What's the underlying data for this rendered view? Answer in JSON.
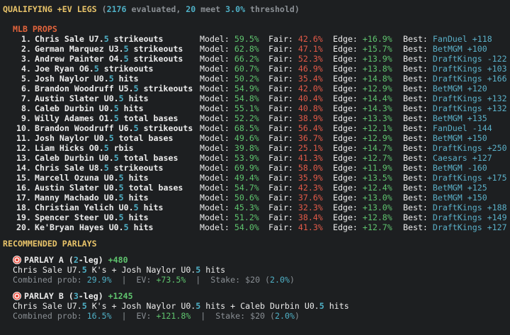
{
  "header": {
    "title": "QUALIFYING +EV LEGS",
    "paren_open": "(",
    "evaluated_count": "2176",
    "evaluated_text": " evaluated, ",
    "meet_count": "20",
    "meet_text": " meet ",
    "threshold_pct": "3.0%",
    "threshold_text": " threshold)"
  },
  "mlb": {
    "title": "MLB PROPS",
    "labels": {
      "model": "Model:",
      "fair": "Fair:",
      "edge": "Edge:",
      "best": "Best:"
    },
    "rows": [
      {
        "num": "1.",
        "pre": "Chris Sale U7.",
        "bold": "5",
        "post": " strikeouts",
        "model": "59.5%",
        "fair": "42.6%",
        "edge": "+16.9%",
        "book": "FanDuel",
        "odds": "+118"
      },
      {
        "num": "2.",
        "pre": "German Marquez U3.",
        "bold": "5",
        "post": " strikeouts",
        "model": "62.8%",
        "fair": "47.1%",
        "edge": "+15.7%",
        "book": "BetMGM",
        "odds": "+100"
      },
      {
        "num": "3.",
        "pre": "Andrew Painter O4.",
        "bold": "5",
        "post": " strikeouts",
        "model": "66.2%",
        "fair": "52.3%",
        "edge": "+13.9%",
        "book": "DraftKings",
        "odds": "-122"
      },
      {
        "num": "4.",
        "pre": "Joe Ryan O6.",
        "bold": "5",
        "post": " strikeouts",
        "model": "60.7%",
        "fair": "46.9%",
        "edge": "+13.8%",
        "book": "DraftKings",
        "odds": "+103"
      },
      {
        "num": "5.",
        "pre": "Josh Naylor U0.",
        "bold": "5",
        "post": " hits",
        "model": "50.2%",
        "fair": "35.4%",
        "edge": "+14.8%",
        "book": "DraftKings",
        "odds": "+166"
      },
      {
        "num": "6.",
        "pre": "Brandon Woodruff U5.",
        "bold": "5",
        "post": " strikeouts",
        "model": "54.9%",
        "fair": "42.0%",
        "edge": "+12.9%",
        "book": "BetMGM",
        "odds": "+120"
      },
      {
        "num": "7.",
        "pre": "Austin Slater U0.",
        "bold": "5",
        "post": " hits",
        "model": "54.8%",
        "fair": "40.4%",
        "edge": "+14.4%",
        "book": "DraftKings",
        "odds": "+132"
      },
      {
        "num": "8.",
        "pre": "Caleb Durbin U0.",
        "bold": "5",
        "post": " hits",
        "model": "55.1%",
        "fair": "40.8%",
        "edge": "+14.3%",
        "book": "DraftKings",
        "odds": "+132"
      },
      {
        "num": "9.",
        "pre": "Willy Adames O1.",
        "bold": "5",
        "post": " total bases",
        "model": "52.2%",
        "fair": "38.9%",
        "edge": "+13.3%",
        "book": "BetMGM",
        "odds": "+135"
      },
      {
        "num": "10.",
        "pre": "Brandon Woodruff U6.",
        "bold": "5",
        "post": " strikeouts",
        "model": "68.5%",
        "fair": "56.4%",
        "edge": "+12.1%",
        "book": "FanDuel",
        "odds": "-144"
      },
      {
        "num": "11.",
        "pre": "Josh Naylor U0.",
        "bold": "5",
        "post": " total bases",
        "model": "49.6%",
        "fair": "36.7%",
        "edge": "+12.9%",
        "book": "BetMGM",
        "odds": "+150"
      },
      {
        "num": "12.",
        "pre": "Liam Hicks O0.",
        "bold": "5",
        "post": " rbis",
        "model": "39.8%",
        "fair": "25.1%",
        "edge": "+14.7%",
        "book": "DraftKings",
        "odds": "+250"
      },
      {
        "num": "13.",
        "pre": "Caleb Durbin U0.",
        "bold": "5",
        "post": " total bases",
        "model": "53.9%",
        "fair": "41.3%",
        "edge": "+12.7%",
        "book": "Caesars",
        "odds": "+127"
      },
      {
        "num": "14.",
        "pre": "Chris Sale U8.",
        "bold": "5",
        "post": " strikeouts",
        "model": "69.9%",
        "fair": "58.0%",
        "edge": "+11.9%",
        "book": "BetMGM",
        "odds": "-160"
      },
      {
        "num": "15.",
        "pre": "Marcell Ozuna U0.",
        "bold": "5",
        "post": " hits",
        "model": "49.4%",
        "fair": "35.9%",
        "edge": "+13.5%",
        "book": "DraftKings",
        "odds": "+175"
      },
      {
        "num": "16.",
        "pre": "Austin Slater U0.",
        "bold": "5",
        "post": " total bases",
        "model": "54.7%",
        "fair": "42.3%",
        "edge": "+12.4%",
        "book": "BetMGM",
        "odds": "+125"
      },
      {
        "num": "17.",
        "pre": "Manny Machado U0.",
        "bold": "5",
        "post": " hits",
        "model": "50.6%",
        "fair": "37.6%",
        "edge": "+13.0%",
        "book": "BetMGM",
        "odds": "+150"
      },
      {
        "num": "18.",
        "pre": "Christian Yelich U0.",
        "bold": "5",
        "post": " hits",
        "model": "45.3%",
        "fair": "32.3%",
        "edge": "+13.0%",
        "book": "DraftKings",
        "odds": "+188"
      },
      {
        "num": "19.",
        "pre": "Spencer Steer U0.",
        "bold": "5",
        "post": " hits",
        "model": "51.2%",
        "fair": "38.4%",
        "edge": "+12.8%",
        "book": "DraftKings",
        "odds": "+149"
      },
      {
        "num": "20.",
        "pre": "Ke'Bryan Hayes U0.",
        "bold": "5",
        "post": " hits",
        "model": "54.0%",
        "fair": "41.3%",
        "edge": "+12.7%",
        "book": "DraftKings",
        "odds": "+127"
      }
    ]
  },
  "parlays": {
    "title": "RECOMMENDED PARLAYS",
    "labels": {
      "combined": "Combined prob: ",
      "ev": "EV: ",
      "stake": "Stake: ",
      "sep": "  |  "
    },
    "items": [
      {
        "label": "PARLAY A",
        "legs_paren_open": " (",
        "legs_num": "2",
        "legs_text": "-leg)",
        "odds": " +480",
        "legs_line": [
          {
            "t": "Chris Sale U7.",
            "k": "w"
          },
          {
            "t": "5",
            "k": "b"
          },
          {
            "t": " K's + Josh Naylor U0.",
            "k": "w"
          },
          {
            "t": "5",
            "k": "b"
          },
          {
            "t": " hits",
            "k": "w"
          }
        ],
        "prob": "29.9%",
        "ev": "+73.5%",
        "stake": "$20",
        "stake_pct_open": " (",
        "stake_pct": "2.0%",
        "stake_pct_close": ")"
      },
      {
        "label": "PARLAY B",
        "legs_paren_open": " (",
        "legs_num": "3",
        "legs_text": "-leg)",
        "odds": " +1245",
        "legs_line": [
          {
            "t": "Chris Sale U7.",
            "k": "w"
          },
          {
            "t": "5",
            "k": "b"
          },
          {
            "t": " K's + Josh Naylor U0.",
            "k": "w"
          },
          {
            "t": "5",
            "k": "b"
          },
          {
            "t": " hits + Caleb Durbin U0.",
            "k": "w"
          },
          {
            "t": "5",
            "k": "b"
          },
          {
            "t": " hits",
            "k": "w"
          }
        ],
        "prob": "16.5%",
        "ev": "+121.8%",
        "stake": "$20",
        "stake_pct_open": " (",
        "stake_pct": "2.0%",
        "stake_pct_close": ")"
      }
    ]
  },
  "colors": {
    "background": "#1d1f21",
    "header_yellow": "#e9c46a",
    "section_orange": "#e3643c",
    "model_green": "#5fc46e",
    "fair_red": "#e35a48",
    "book_cyan": "#5ab0c8",
    "muted": "#8a8f94"
  },
  "icons": {
    "parlay": "target-icon"
  }
}
